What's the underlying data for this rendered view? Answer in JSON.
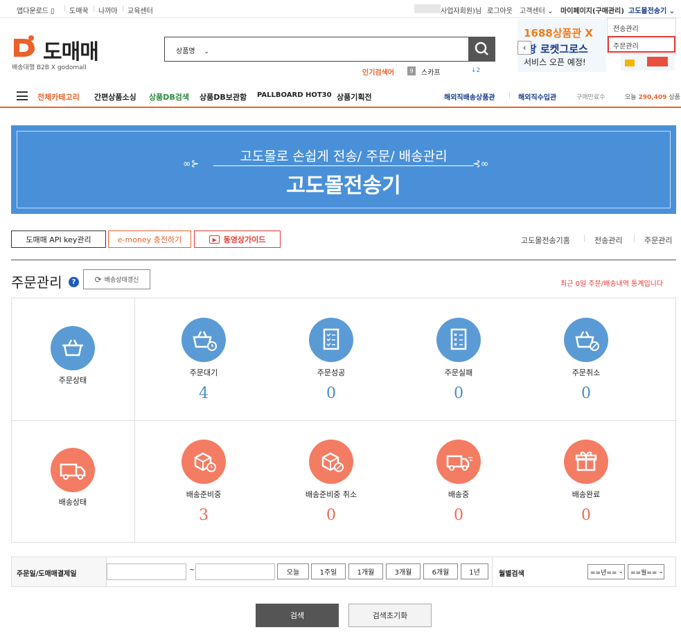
{
  "topbar": {
    "left": [
      "앱다운로드",
      "도매꾹",
      "나까마",
      "교육센터"
    ],
    "user_suffix": "사업자회원)님",
    "logout": "로그아웃",
    "customer_center": "고객센터",
    "mypage": "마이페이지(구매관리)",
    "transfer_menu": "고도몰전송기"
  },
  "dropdown": {
    "items": [
      "전송관리",
      "주문관리"
    ]
  },
  "logo": {
    "name": "도매매",
    "sub": "배송대행 B2B  X  godomall"
  },
  "search": {
    "category": "상품명",
    "popular_label": "인기검색어",
    "popular_rank": "9",
    "popular_term": "스카프",
    "popular_change": "↓2"
  },
  "ad": {
    "line1": "1688상품관 X",
    "line2": "쿠팡 로켓그로스",
    "line3": "서비스 오픈 예정!"
  },
  "nav": {
    "all_category": "전체카테고리",
    "items": [
      "간편상품소싱",
      "상품DB검색",
      "상품DB보관함",
      "PALLBOARD HOT30",
      "상품기획전"
    ],
    "right": [
      "해외직배송상품관",
      "해외직수입관"
    ],
    "purchase_count_label": "구매만료수",
    "today_label": "오늘",
    "today_count": "290,409",
    "today_unit": "상품"
  },
  "banner": {
    "subtitle": "고도몰로 손쉽게 전송/ 주문/ 배송관리",
    "title": "고도몰전송기"
  },
  "actions": {
    "api_key": "도매매 API key관리",
    "emoney": "e-money 충전하기",
    "video": "동영상가이드",
    "links": [
      "고도몰전송기홈",
      "전송관리",
      "주문관리"
    ]
  },
  "section": {
    "title": "주문관리",
    "refresh": "배송상태갱신",
    "notice": "최근 0일 주문/배송내역 통계입니다"
  },
  "order_status": {
    "label": "주문상태",
    "items": [
      {
        "label": "주문대기",
        "value": "4"
      },
      {
        "label": "주문성공",
        "value": "0"
      },
      {
        "label": "주문실패",
        "value": "0"
      },
      {
        "label": "주문취소",
        "value": "0"
      }
    ]
  },
  "delivery_status": {
    "label": "배송상태",
    "items": [
      {
        "label": "배송준비중",
        "value": "3"
      },
      {
        "label": "배송준비중 취소",
        "value": "0"
      },
      {
        "label": "배송중",
        "value": "0"
      },
      {
        "label": "배송완료",
        "value": "0"
      }
    ]
  },
  "filter": {
    "date_label": "주문일/도매매결제일",
    "tilde": "~",
    "periods": [
      "오늘",
      "1주일",
      "1개월",
      "3개월",
      "6개월",
      "1년"
    ],
    "monthly_label": "월별검색",
    "year_select": "==년==",
    "month_select": "==월=="
  },
  "bottom": {
    "search": "검색",
    "reset": "검색초기화"
  },
  "colors": {
    "accent": "#e9622b",
    "blue_circle": "#5b9bd5",
    "red_circle": "#f47c63",
    "banner": "#4a90d9"
  }
}
